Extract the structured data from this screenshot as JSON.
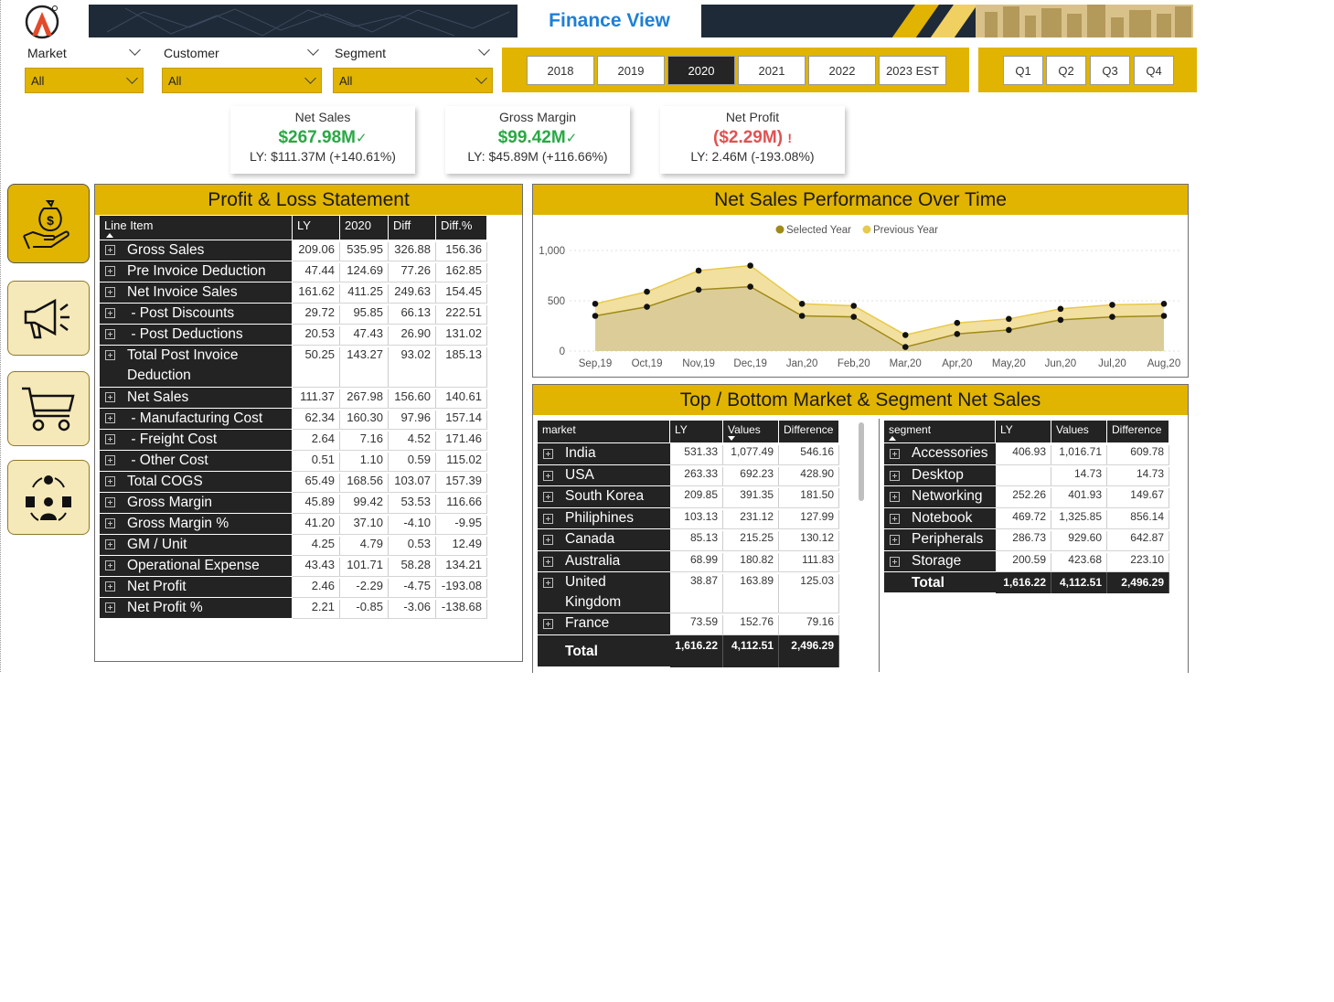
{
  "header": {
    "title": "Finance View",
    "colors": {
      "accent": "#e0b400",
      "dark": "#232323",
      "title_blue": "#1e7fd6",
      "positive": "#2aa845",
      "negative": "#e05252"
    }
  },
  "filters": {
    "market": {
      "label": "Market",
      "value": "All"
    },
    "customer": {
      "label": "Customer",
      "value": "All"
    },
    "segment": {
      "label": "Segment",
      "value": "All"
    }
  },
  "years": [
    "2018",
    "2019",
    "2020",
    "2021",
    "2022",
    "2023 EST"
  ],
  "selected_year": "2020",
  "quarters": [
    "Q1",
    "Q2",
    "Q3",
    "Q4"
  ],
  "kpis": [
    {
      "title": "Net Sales",
      "value": "$267.98M",
      "status": "✓",
      "ly": "LY: $111.37M (+140.61%)",
      "tone": "positive"
    },
    {
      "title": "Gross Margin",
      "value": "$99.42M",
      "status": "✓",
      "ly": "LY: $45.89M (+116.66%)",
      "tone": "positive"
    },
    {
      "title": "Net Profit",
      "value": "($2.29M)",
      "status": "!",
      "ly": "LY: 2.46M (-193.08%)",
      "tone": "negative"
    }
  ],
  "nav": [
    "money-hand-icon",
    "megaphone-icon",
    "shopping-cart-icon",
    "supply-chain-icon"
  ],
  "pl": {
    "title": "Profit & Loss Statement",
    "columns": [
      "Line Item",
      "LY",
      "2020",
      "Diff",
      "Diff.%"
    ],
    "rows": [
      {
        "label": "Gross Sales",
        "ly": "209.06",
        "cur": "535.95",
        "diff": "326.88",
        "pct": "156.36"
      },
      {
        "label": "Pre Invoice Deduction",
        "ly": "47.44",
        "cur": "124.69",
        "diff": "77.26",
        "pct": "162.85"
      },
      {
        "label": "Net Invoice Sales",
        "ly": "161.62",
        "cur": "411.25",
        "diff": "249.63",
        "pct": "154.45"
      },
      {
        "label": " - Post Discounts",
        "ly": "29.72",
        "cur": "95.85",
        "diff": "66.13",
        "pct": "222.51"
      },
      {
        "label": " - Post Deductions",
        "ly": "20.53",
        "cur": "47.43",
        "diff": "26.90",
        "pct": "131.02"
      },
      {
        "label": "Total Post Invoice Deduction",
        "ly": "50.25",
        "cur": "143.27",
        "diff": "93.02",
        "pct": "185.13"
      },
      {
        "label": "Net Sales",
        "ly": "111.37",
        "cur": "267.98",
        "diff": "156.60",
        "pct": "140.61"
      },
      {
        "label": " - Manufacturing Cost",
        "ly": "62.34",
        "cur": "160.30",
        "diff": "97.96",
        "pct": "157.14"
      },
      {
        "label": " - Freight Cost",
        "ly": "2.64",
        "cur": "7.16",
        "diff": "4.52",
        "pct": "171.46"
      },
      {
        "label": " - Other Cost",
        "ly": "0.51",
        "cur": "1.10",
        "diff": "0.59",
        "pct": "115.02"
      },
      {
        "label": "Total COGS",
        "ly": "65.49",
        "cur": "168.56",
        "diff": "103.07",
        "pct": "157.39"
      },
      {
        "label": "Gross Margin",
        "ly": "45.89",
        "cur": "99.42",
        "diff": "53.53",
        "pct": "116.66"
      },
      {
        "label": "Gross Margin %",
        "ly": "41.20",
        "cur": "37.10",
        "diff": "-4.10",
        "pct": "-9.95"
      },
      {
        "label": "GM / Unit",
        "ly": "4.25",
        "cur": "4.79",
        "diff": "0.53",
        "pct": "12.49"
      },
      {
        "label": "Operational Expense",
        "ly": "43.43",
        "cur": "101.71",
        "diff": "58.28",
        "pct": "134.21"
      },
      {
        "label": "Net Profit",
        "ly": "2.46",
        "cur": "-2.29",
        "diff": "-4.75",
        "pct": "-193.08"
      },
      {
        "label": "Net Profit %",
        "ly": "2.21",
        "cur": "-0.85",
        "diff": "-3.06",
        "pct": "-138.68"
      }
    ]
  },
  "chart_data": {
    "type": "area",
    "title": "Net Sales Performance Over Time",
    "categories": [
      "Sep,19",
      "Oct,19",
      "Nov,19",
      "Dec,19",
      "Jan,20",
      "Feb,20",
      "Mar,20",
      "Apr,20",
      "May,20",
      "Jun,20",
      "Jul,20",
      "Aug,20"
    ],
    "series": [
      {
        "name": "Selected Year",
        "color": "#a08a18",
        "values": [
          350,
          440,
          610,
          640,
          350,
          340,
          40,
          170,
          210,
          310,
          340,
          350
        ]
      },
      {
        "name": "Previous Year",
        "color": "#e8c94a",
        "values": [
          470,
          590,
          800,
          850,
          470,
          450,
          160,
          280,
          320,
          420,
          460,
          470
        ]
      }
    ],
    "ylim": [
      0,
      1000
    ],
    "yticks": [
      "0",
      "500",
      "1,000"
    ],
    "legend": "top-center",
    "grid": true
  },
  "market_panel": {
    "title": "Top / Bottom Market & Segment Net Sales"
  },
  "markets": {
    "columns": [
      "market",
      "LY",
      "Values",
      "Difference"
    ],
    "rows": [
      {
        "label": "India",
        "ly": "531.33",
        "val": "1,077.49",
        "diff": "546.16"
      },
      {
        "label": "USA",
        "ly": "263.33",
        "val": "692.23",
        "diff": "428.90"
      },
      {
        "label": "South Korea",
        "ly": "209.85",
        "val": "391.35",
        "diff": "181.50"
      },
      {
        "label": "Philiphines",
        "ly": "103.13",
        "val": "231.12",
        "diff": "127.99"
      },
      {
        "label": "Canada",
        "ly": "85.13",
        "val": "215.25",
        "diff": "130.12"
      },
      {
        "label": "Australia",
        "ly": "68.99",
        "val": "180.82",
        "diff": "111.83"
      },
      {
        "label": "United Kingdom",
        "ly": "38.87",
        "val": "163.89",
        "diff": "125.03"
      },
      {
        "label": "France",
        "ly": "73.59",
        "val": "152.76",
        "diff": "79.16"
      }
    ],
    "total": {
      "label": "Total",
      "ly": "1,616.22",
      "val": "4,112.51",
      "diff": "2,496.29"
    }
  },
  "segments": {
    "columns": [
      "segment",
      "LY",
      "Values",
      "Difference"
    ],
    "rows": [
      {
        "label": "Accessories",
        "ly": "406.93",
        "val": "1,016.71",
        "diff": "609.78"
      },
      {
        "label": "Desktop",
        "ly": "",
        "val": "14.73",
        "diff": "14.73"
      },
      {
        "label": "Networking",
        "ly": "252.26",
        "val": "401.93",
        "diff": "149.67"
      },
      {
        "label": "Notebook",
        "ly": "469.72",
        "val": "1,325.85",
        "diff": "856.14"
      },
      {
        "label": "Peripherals",
        "ly": "286.73",
        "val": "929.60",
        "diff": "642.87"
      },
      {
        "label": "Storage",
        "ly": "200.59",
        "val": "423.68",
        "diff": "223.10"
      }
    ],
    "total": {
      "label": "Total",
      "ly": "1,616.22",
      "val": "4,112.51",
      "diff": "2,496.29"
    }
  }
}
